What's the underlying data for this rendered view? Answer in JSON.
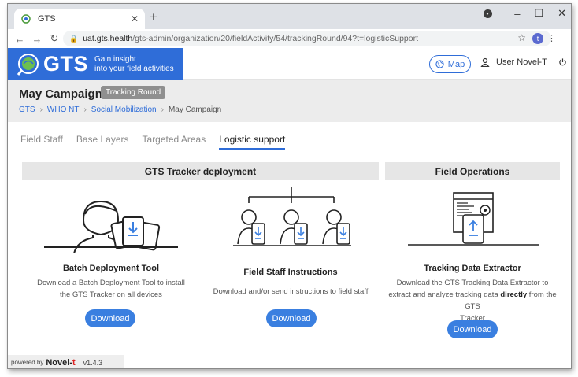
{
  "browser": {
    "tab_title": "GTS",
    "tab_close": "✕",
    "new_tab": "+",
    "url_host": "uat.gts.health",
    "url_path": "/gts-admin/organization/20/fieldActivity/54/trackingRound/94?t=logisticSupport",
    "profile_initial": "t",
    "win_min": "–",
    "win_max": "☐",
    "win_close": "✕"
  },
  "header": {
    "brand": "GTS",
    "tagline_1": "Gain insight",
    "tagline_2": "into your field activities",
    "map_label": "Map",
    "user_label": "User Novel-T"
  },
  "campaign": {
    "title": "May Campaign",
    "badge": "Tracking Round",
    "breadcrumb": [
      "GTS",
      "WHO NT",
      "Social Mobilization",
      "May Campaign"
    ]
  },
  "tabs": [
    {
      "label": "Field Staff",
      "active": false
    },
    {
      "label": "Base Layers",
      "active": false
    },
    {
      "label": "Targeted Areas",
      "active": false
    },
    {
      "label": "Logistic support",
      "active": true
    }
  ],
  "sections": {
    "tracker": "GTS Tracker deployment",
    "field_ops": "Field Operations"
  },
  "cards": {
    "batch": {
      "title": "Batch Deployment Tool",
      "desc_1": "Download a Batch Deployment Tool to install",
      "desc_2": "the GTS Tracker on all devices",
      "button": "Download"
    },
    "instructions": {
      "title": "Field Staff Instructions",
      "desc_1": "Download and/or send instructions to field staff",
      "button": "Download"
    },
    "extractor": {
      "title": "Tracking Data Extractor",
      "desc_1": "Download the GTS Tracking Data Extractor to",
      "desc_2a": "extract and analyze tracking data ",
      "desc_2b": "directly",
      "desc_2c": " from the GTS",
      "desc_3": "Tracker",
      "button": "Download"
    }
  },
  "footer": {
    "powered_by": "powered by",
    "company_a": "Novel-",
    "company_b": "t",
    "version": "v1.4.3"
  },
  "colors": {
    "brand_blue": "#2f6dd8",
    "button_blue": "#3a7fe0"
  },
  "icons": [
    "gts-favicon",
    "back-arrow",
    "forward-arrow",
    "reload",
    "lock",
    "star",
    "globe",
    "person",
    "power",
    "download-arrow"
  ]
}
